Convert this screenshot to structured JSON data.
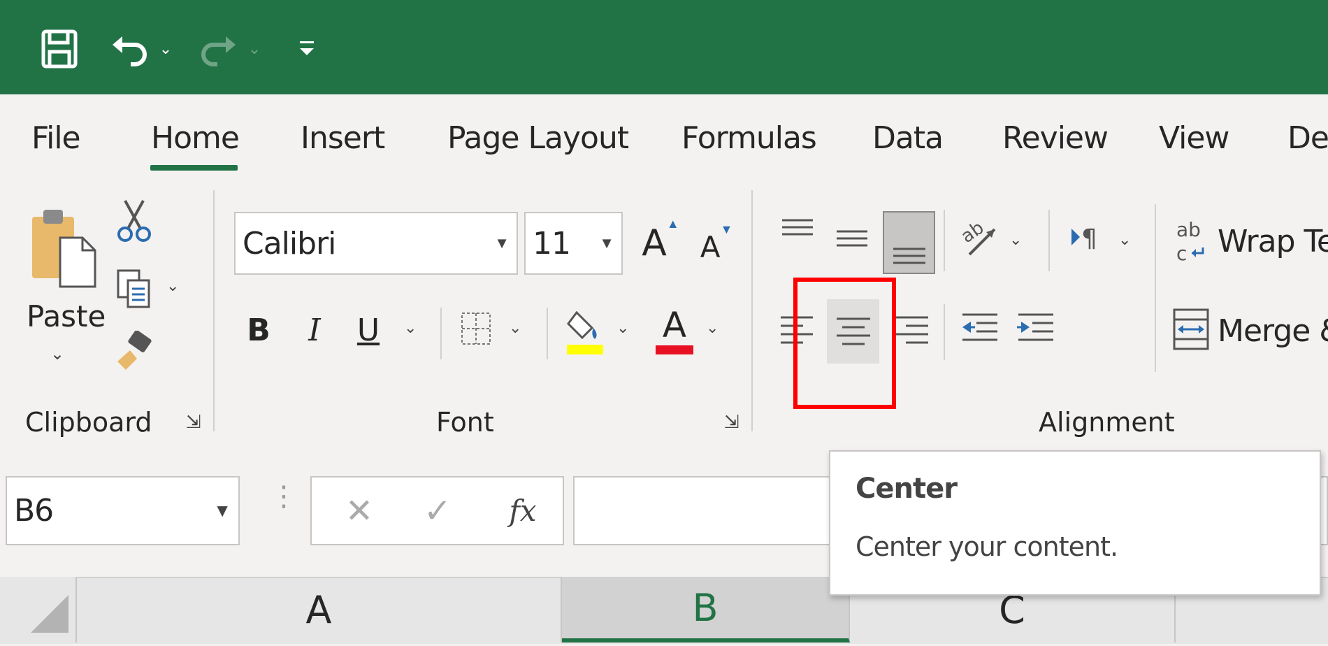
{
  "quick_access": {
    "icons": [
      "save-icon",
      "undo-icon",
      "redo-icon",
      "customize-qat-icon"
    ]
  },
  "tabs": [
    "File",
    "Home",
    "Insert",
    "Page Layout",
    "Formulas",
    "Data",
    "Review",
    "View",
    "Dev"
  ],
  "active_tab": "Home",
  "clipboard": {
    "paste_label": "Paste",
    "group_label": "Clipboard"
  },
  "font": {
    "name": "Calibri",
    "size": "11",
    "group_label": "Font",
    "bold_label": "B",
    "italic_label": "I",
    "underline_label": "U",
    "font_color_letter": "A",
    "grow_letter": "A",
    "shrink_letter": "A"
  },
  "alignment": {
    "group_label": "Alignment",
    "wrap_text_label": "Wrap Tex",
    "merge_label": "Merge &"
  },
  "formula_bar": {
    "name_box": "B6",
    "fx_label": "fx",
    "formula_value": ""
  },
  "columns": [
    "A",
    "B",
    "C"
  ],
  "selected_column": "B",
  "tooltip": {
    "title": "Center",
    "description": "Center your content."
  },
  "colors": {
    "brand_green": "#217346",
    "highlight_yellow": "#ffff00",
    "font_red": "#ff0000",
    "annotation_red": "#ff0000"
  }
}
